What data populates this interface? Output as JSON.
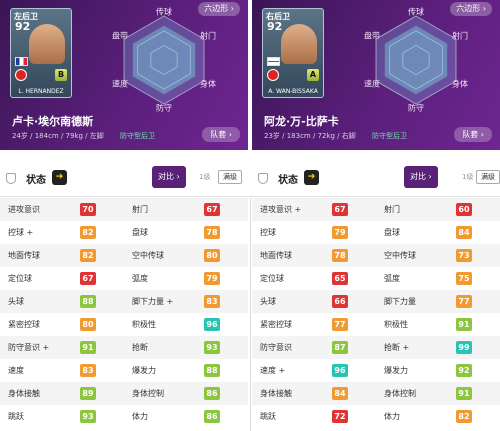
{
  "left": {
    "card": {
      "pos": "左后卫",
      "ovr": "92",
      "grade": "B",
      "name": "L. HERNANDEZ"
    },
    "hex": {
      "labels": [
        "传球",
        "射门",
        "身体",
        "防守",
        "速度",
        "盘带"
      ],
      "button": "六边形 ›"
    },
    "name": "卢卡·埃尔南德斯",
    "info": "24岁 / 184cm / 79kg / 左脚",
    "role": "防守型后卫",
    "team_button": "队套 ›",
    "bar": {
      "title": "状态",
      "arrow": "➔",
      "compare": "对比 ›",
      "level": "1级",
      "max": "满级"
    },
    "stats": [
      [
        "进攻意识",
        "70",
        "#e03434",
        "射门",
        "67",
        "#e03434"
      ],
      [
        "控球 +",
        "82",
        "#f19a32",
        "盘球",
        "78",
        "#f19a32"
      ],
      [
        "地面传球",
        "82",
        "#f19a32",
        "空中传球",
        "80",
        "#f19a32"
      ],
      [
        "定位球",
        "67",
        "#e03434",
        "弧度",
        "79",
        "#f19a32"
      ],
      [
        "头球",
        "88",
        "#8cc63f",
        "脚下力量 +",
        "83",
        "#f19a32"
      ],
      [
        "紧密控球",
        "80",
        "#f19a32",
        "积极性",
        "96",
        "#27c4b4"
      ],
      [
        "防守意识 +",
        "91",
        "#8cc63f",
        "抢断",
        "93",
        "#8cc63f"
      ],
      [
        "速度",
        "83",
        "#f19a32",
        "爆发力",
        "88",
        "#8cc63f"
      ],
      [
        "身体接触",
        "89",
        "#8cc63f",
        "身体控制",
        "86",
        "#8cc63f"
      ],
      [
        "跳跃",
        "93",
        "#8cc63f",
        "体力",
        "86",
        "#8cc63f"
      ]
    ]
  },
  "right": {
    "card": {
      "pos": "右后卫",
      "ovr": "92",
      "grade": "A",
      "name": "A. WAN-BISSAKA"
    },
    "hex": {
      "labels": [
        "传球",
        "射门",
        "身体",
        "防守",
        "速度",
        "盘带"
      ],
      "button": "六边形 ›"
    },
    "name": "阿龙·万-比萨卡",
    "info": "23岁 / 183cm / 72kg / 右脚",
    "role": "防守型后卫",
    "team_button": "队套 ›",
    "bar": {
      "title": "状态",
      "arrow": "➔",
      "compare": "对比 ›",
      "level": "1级",
      "max": "满级"
    },
    "stats": [
      [
        "进攻意识 +",
        "67",
        "#e03434",
        "射门",
        "60",
        "#e03434"
      ],
      [
        "控球",
        "79",
        "#f19a32",
        "盘球",
        "84",
        "#f19a32"
      ],
      [
        "地面传球",
        "78",
        "#f19a32",
        "空中传球",
        "73",
        "#f19a32"
      ],
      [
        "定位球",
        "65",
        "#e03434",
        "弧度",
        "75",
        "#f19a32"
      ],
      [
        "头球",
        "66",
        "#e03434",
        "脚下力量",
        "77",
        "#f19a32"
      ],
      [
        "紧密控球",
        "77",
        "#f19a32",
        "积极性",
        "91",
        "#8cc63f"
      ],
      [
        "防守意识",
        "87",
        "#8cc63f",
        "抢断 +",
        "99",
        "#27c4b4"
      ],
      [
        "速度 +",
        "96",
        "#27c4b4",
        "爆发力",
        "92",
        "#8cc63f"
      ],
      [
        "身体接触",
        "84",
        "#f19a32",
        "身体控制",
        "91",
        "#8cc63f"
      ],
      [
        "跳跃",
        "72",
        "#e03434",
        "体力",
        "82",
        "#f19a32"
      ]
    ]
  }
}
